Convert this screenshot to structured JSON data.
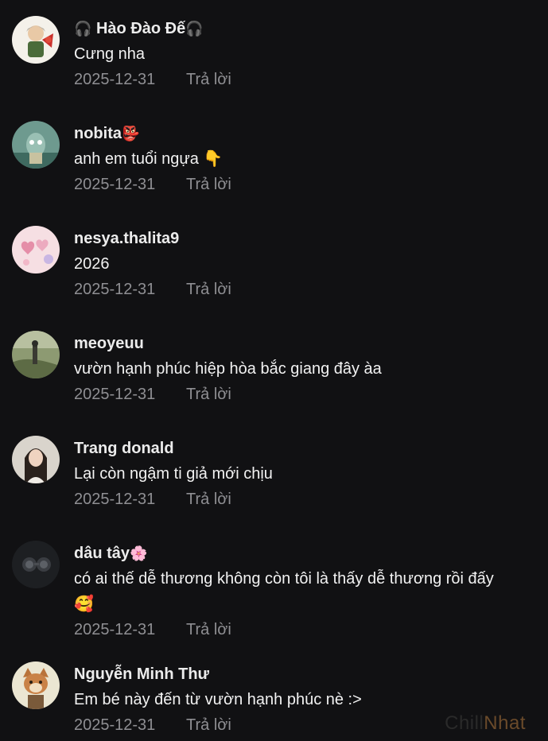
{
  "comments": [
    {
      "username": "Hào Đào Đế",
      "name_prefix_emoji": "🎧",
      "name_suffix_emoji": "🎧",
      "text": "Cưng nha",
      "date": "2025-12-31",
      "reply_label": "Trả lời",
      "avatar_icon": "cartoon-character-avatar"
    },
    {
      "username": "nobita",
      "name_suffix_emoji": "👺",
      "text": "anh em tuổi ngựa 👇",
      "date": "2025-12-31",
      "reply_label": "Trả lời",
      "avatar_icon": "cartoon-squid-avatar"
    },
    {
      "username": "nesya.thalita9",
      "text": "2026",
      "date": "2025-12-31",
      "reply_label": "Trả lời",
      "avatar_icon": "pink-hearts-avatar"
    },
    {
      "username": "meoyeuu",
      "text": "vườn hạnh phúc hiệp hòa bắc giang đây àa",
      "date": "2025-12-31",
      "reply_label": "Trả lời",
      "avatar_icon": "outdoor-photo-avatar"
    },
    {
      "username": "Trang donald",
      "text": "Lại còn ngậm ti giả mới chịu",
      "date": "2025-12-31",
      "reply_label": "Trả lời",
      "avatar_icon": "portrait-photo-avatar"
    },
    {
      "username": "dâu tây",
      "name_suffix_emoji": "🌸",
      "text": "có ai thế dễ thương không còn tôi là thấy dễ thương rồi đấy",
      "text_line2": "🥰",
      "date": "2025-12-31",
      "reply_label": "Trả lời",
      "avatar_icon": "dark-photo-avatar"
    },
    {
      "username": "Nguyễn Minh Thư",
      "text": "Em bé này đến từ vườn hạnh phúc nè :>",
      "date": "2025-12-31",
      "reply_label": "Trả lời",
      "avatar_icon": "cartoon-cat-avatar"
    }
  ],
  "watermark": {
    "part1": "Chill",
    "part2": "Nhat"
  }
}
